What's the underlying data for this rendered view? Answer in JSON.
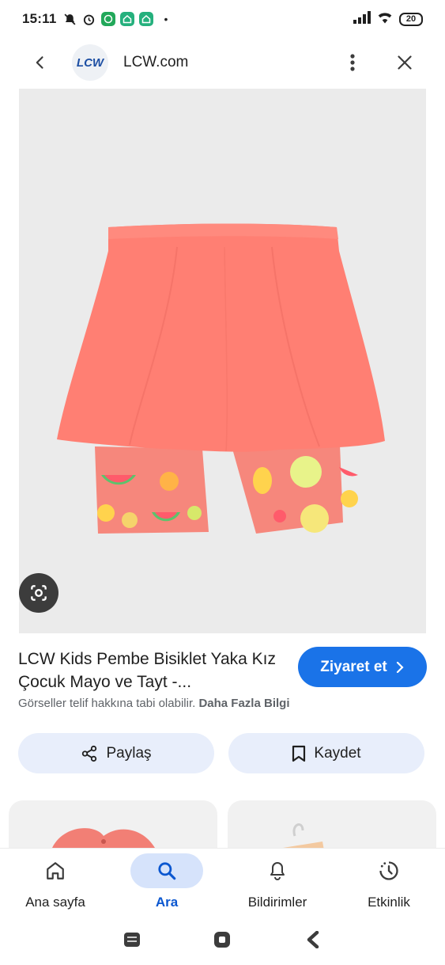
{
  "status_bar": {
    "time": "15:11",
    "dot": "•",
    "battery": "20",
    "icons": [
      "mute-icon",
      "alarm-icon",
      "whatsapp-icon",
      "app-icon",
      "app-icon"
    ]
  },
  "header": {
    "site_logo": "LCW",
    "site_name": "LCW.com"
  },
  "product": {
    "title": "LCW Kids Pembe Bisiklet Yaka Kız Çocuk Mayo ve Tayt -...",
    "visit_label": "Ziyaret et",
    "copyright_text": "Görseller telif hakkına tabi olabilir.",
    "more_info_label": "Daha Fazla Bilgi",
    "share_label": "Paylaş",
    "save_label": "Kaydet"
  },
  "bottom_nav": {
    "items": [
      {
        "label": "Ana sayfa",
        "icon": "home-icon",
        "active": false
      },
      {
        "label": "Ara",
        "icon": "search-icon",
        "active": true
      },
      {
        "label": "Bildirimler",
        "icon": "bell-icon",
        "active": false
      },
      {
        "label": "Etkinlik",
        "icon": "activity-icon",
        "active": false
      }
    ]
  },
  "colors": {
    "accent": "#1a73e8",
    "active_nav": "#0b57d0",
    "skirt": "#ff7f73",
    "leggings": "#f6877c"
  }
}
